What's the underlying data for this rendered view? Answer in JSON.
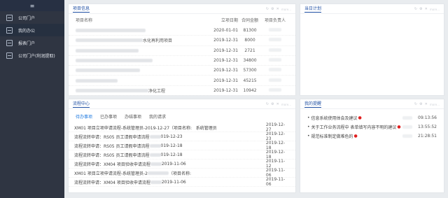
{
  "sidebar": {
    "menu_icon": "≡",
    "items": [
      {
        "label": "公司门户",
        "icon": "portal-icon",
        "active": false
      },
      {
        "label": "我的办公",
        "icon": "office-icon",
        "active": true
      },
      {
        "label": "报表门户",
        "icon": "report-icon",
        "active": false
      },
      {
        "label": "公司门户(利润提取)",
        "icon": "profit-portal-icon",
        "active": false
      }
    ]
  },
  "project_panel": {
    "title": "项目信息",
    "more": "more...",
    "columns": {
      "name": "项目名称",
      "date": "立项日期",
      "amount": "合同金额",
      "person": "项目负责人"
    },
    "rows": [
      {
        "name_suffix": "",
        "date": "2020-01-01",
        "amount": "81300"
      },
      {
        "name_suffix": "水化再利用项目",
        "date": "2019-12-31",
        "amount": "8000"
      },
      {
        "name_suffix": "",
        "date": "2019-12-31",
        "amount": "2721"
      },
      {
        "name_suffix": "",
        "date": "2019-12-31",
        "amount": "34800"
      },
      {
        "name_suffix": "",
        "date": "2019-12-31",
        "amount": "57300"
      },
      {
        "name_suffix": "",
        "date": "2019-12-31",
        "amount": "45215"
      },
      {
        "name_suffix": "净化工程",
        "date": "2019-12-31",
        "amount": "10942"
      }
    ]
  },
  "plan_panel": {
    "title": "当日计划",
    "more": "more..."
  },
  "flow_panel": {
    "title": "流程中心",
    "more": "more...",
    "tabs": [
      "待办事项",
      "已办事项",
      "办结事项",
      "我的请求"
    ],
    "rows": [
      {
        "title": "XM01 项目立项申请流程-系统管理员-2019-12-27（项目名称:",
        "extra": "系统管理员",
        "date": "2019-12-27"
      },
      {
        "title": "流程流转申请：RS05 员工请假申请流程",
        "extra": "019-12-23",
        "date": "2019-12-23"
      },
      {
        "title": "流程流转申请：RS05 员工请假申请流程",
        "extra": "019-12-18",
        "date": "2019-12-18"
      },
      {
        "title": "流程流转申请：RS05 员工请假申请流程",
        "extra": "019-12-18",
        "date": "2019-12-18"
      },
      {
        "title": "流程流转申请：XM04 项目验收申请流程",
        "extra": "2019-11-06",
        "date": "2019-11-12"
      },
      {
        "title": "XM01 项目立项申请流程-系统管理员-2",
        "extra": "（项目名称:",
        "date": "2019-11-06"
      },
      {
        "title": "流程流转申请：XM04 项目验收申请流程",
        "extra": "2019-11-06",
        "date": "2019-11-06"
      }
    ]
  },
  "reminder_panel": {
    "title": "我的提醒",
    "more": "more...",
    "rows": [
      {
        "text": "信息系统使用体会及建议",
        "time": "09:13:56"
      },
      {
        "text": "关于工作业务流程中 表单填写内容不明的建议",
        "time": "13:55:52"
      },
      {
        "text": "规范标准制定做难色的",
        "time": "21:28:51"
      }
    ]
  },
  "colors": {
    "sidebar": "#2f3542",
    "accent": "#1f4fa3",
    "tab_active": "#1f7ae0",
    "alert": "#e02020"
  }
}
